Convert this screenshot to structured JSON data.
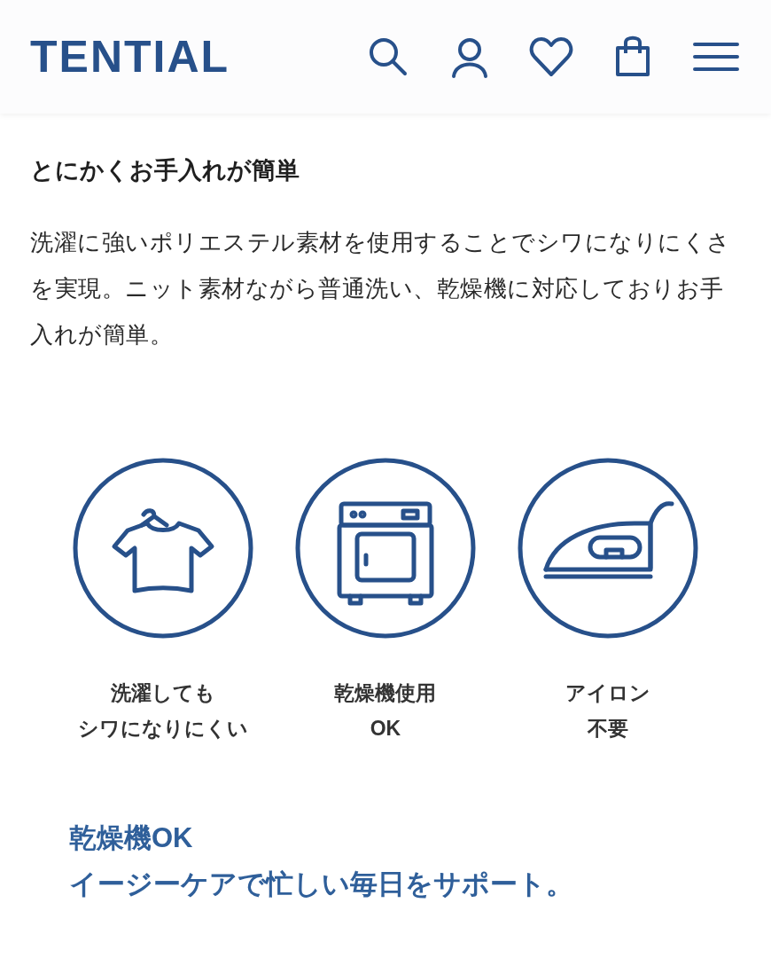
{
  "header": {
    "logo": "TENTIAL"
  },
  "section": {
    "heading": "とにかくお手入れが簡単",
    "body": "洗濯に強いポリエステル素材を使用することでシワになりにくさを実現。ニット素材ながら普通洗い、乾燥機に対応しておりお手入れが簡単。"
  },
  "features": [
    {
      "kind": "shirt",
      "lines": [
        "洗濯しても",
        "シワになりにくい"
      ]
    },
    {
      "kind": "dryer",
      "lines": [
        "乾燥機使用",
        "OK"
      ]
    },
    {
      "kind": "iron",
      "lines": [
        "アイロン",
        "不要"
      ]
    }
  ],
  "tagline": [
    "乾燥機OK",
    "イージーケアで忙しい毎日をサポート。"
  ]
}
